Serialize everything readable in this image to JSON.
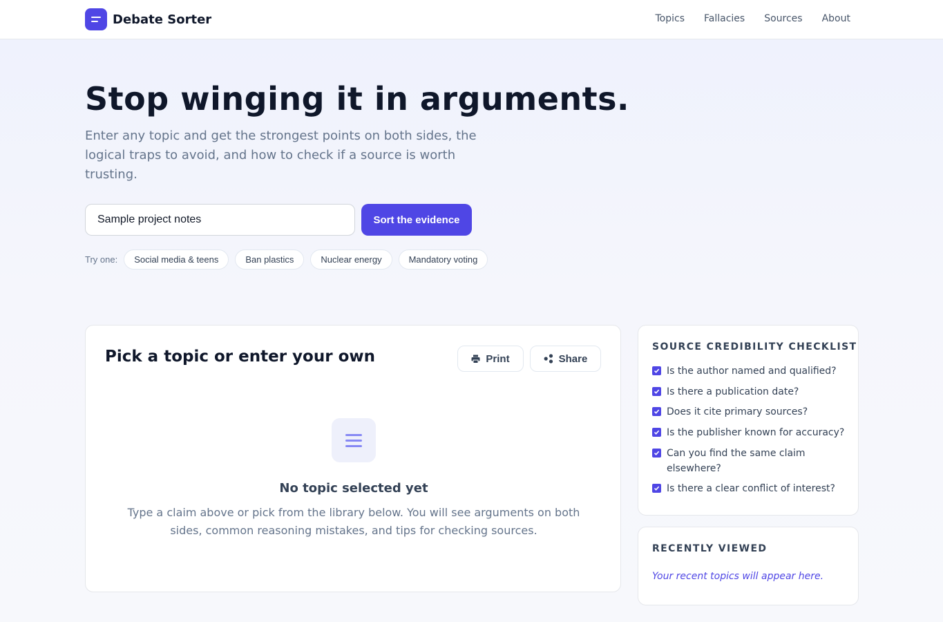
{
  "header": {
    "brand": "Debate Sorter",
    "nav": [
      "Topics",
      "Fallacies",
      "Sources",
      "About"
    ]
  },
  "hero": {
    "title": "Stop winging it in arguments.",
    "subtitle": "Enter any topic and get the strongest points on both sides, the logical traps to avoid, and how to check if a source is worth trusting.",
    "search_value": "Sample project notes",
    "search_button": "Sort the evidence",
    "try_label": "Try one:",
    "suggestions": [
      "Social media & teens",
      "Ban plastics",
      "Nuclear energy",
      "Mandatory voting"
    ]
  },
  "main": {
    "title": "Pick a topic or enter your own",
    "print_label": "Print",
    "share_label": "Share",
    "empty_title": "No topic selected yet",
    "empty_text": "Type a claim above or pick from the library below. You will see arguments on both sides, common reasoning mistakes, and tips for checking sources."
  },
  "checklist": {
    "heading": "SOURCE CREDIBILITY CHECKLIST",
    "items": [
      "Is the author named and qualified?",
      "Is there a publication date?",
      "Does it cite primary sources?",
      "Is the publisher known for accuracy?",
      "Can you find the same claim elsewhere?",
      "Is there a clear conflict of interest?"
    ]
  },
  "recent": {
    "heading": "RECENTLY VIEWED",
    "empty": "Your recent topics will appear here."
  },
  "colors": {
    "accent": "#4f46e5",
    "text": "#0f172a",
    "muted": "#64748b"
  },
  "icons": {
    "logo": "lines-icon",
    "print": "printer-icon",
    "share": "share-icon",
    "empty": "document-lines-icon",
    "check": "checkbox-checked-icon"
  }
}
